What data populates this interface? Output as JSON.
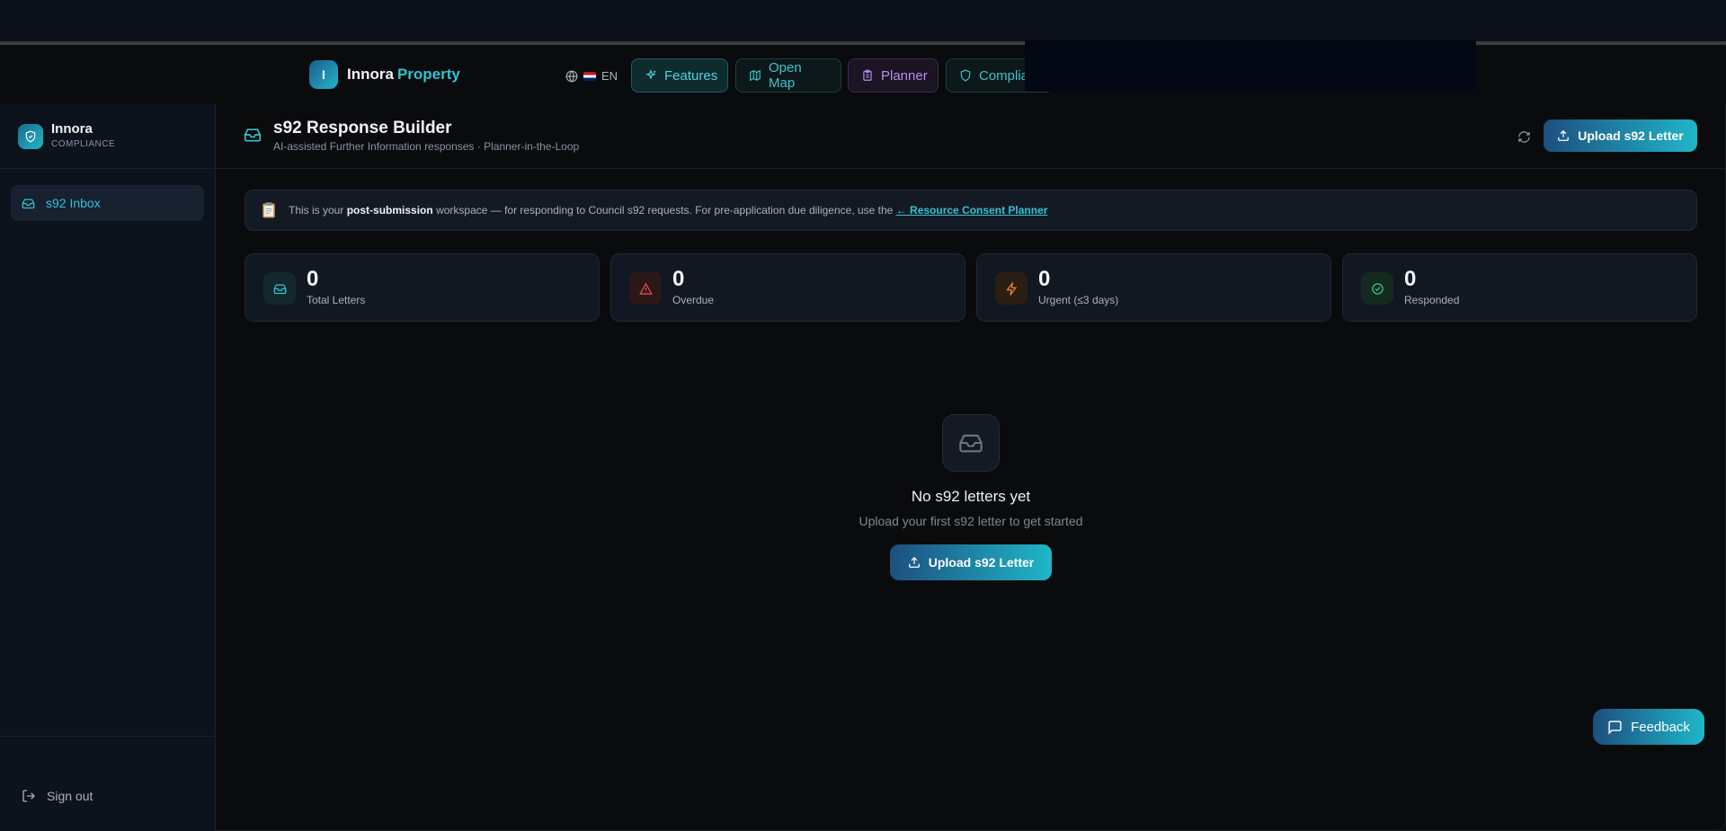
{
  "topnav": {
    "brand_initial": "I",
    "brand_name": "Innora",
    "brand_suffix": "Property",
    "language": "EN",
    "items": [
      {
        "label": "Features"
      },
      {
        "label": "Open Map"
      },
      {
        "label": "Planner"
      },
      {
        "label": "Complia"
      }
    ]
  },
  "sidebar": {
    "title": "Innora",
    "subtitle": "COMPLIANCE",
    "items": [
      {
        "label": "s92 Inbox"
      }
    ],
    "sign_out": "Sign out"
  },
  "header": {
    "title": "s92 Response Builder",
    "subtitle": "AI-assisted Further Information responses · Planner-in-the-Loop",
    "upload_label": "Upload s92 Letter"
  },
  "notice": {
    "text_before": "This is your",
    "bold": "post-submission",
    "text_after": "workspace — for responding to Council s92 requests. For pre-application due diligence, use the",
    "link": "← Resource Consent Planner"
  },
  "stats": [
    {
      "value": "0",
      "label": "Total Letters"
    },
    {
      "value": "0",
      "label": "Overdue"
    },
    {
      "value": "0",
      "label": "Urgent (≤3 days)"
    },
    {
      "value": "0",
      "label": "Responded"
    }
  ],
  "empty": {
    "title": "No s92 letters yet",
    "subtitle": "Upload your first s92 letter to get started",
    "upload_label": "Upload s92 Letter"
  },
  "feedback_label": "Feedback",
  "colors": {
    "accent": "#22b6c9",
    "background": "#0a0b0d",
    "overdue": "#e0564f",
    "urgent": "#e8863a",
    "responded": "#3cc48a"
  }
}
